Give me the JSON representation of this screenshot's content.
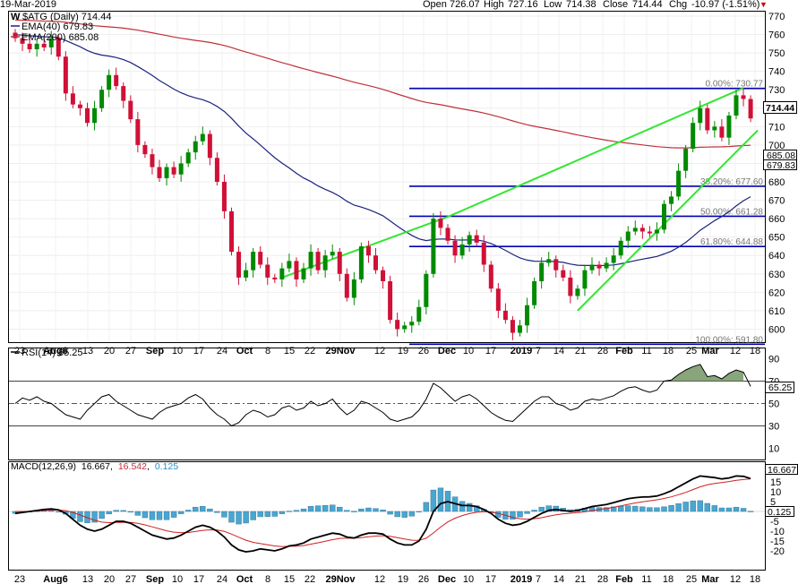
{
  "header": {
    "date": "19-Mar-2019",
    "open_label": "Open",
    "open": "726.07",
    "high_label": "High",
    "high": "727.16",
    "low_label": "Low",
    "low": "714.38",
    "close_label": "Close",
    "close": "714.44",
    "chg_label": "Chg",
    "chg": "-10.97 (-1.51%)"
  },
  "legend": {
    "title": "$ATG (Daily) 714.44",
    "ema40": "EMA(40) 679.83",
    "ema200": "EMA(200) 685.08"
  },
  "price_tags": {
    "close": "714.44",
    "ema200": "685.08",
    "ema40": "679.83"
  },
  "fib_labels": [
    "0.00%: 730.77",
    "38.20%: 677.60",
    "50.00%: 661.28",
    "61.80%: 644.88",
    "100.00%: 591.80"
  ],
  "rsi_legend": "RSI(14) 65.25",
  "rsi_tag": "65.25",
  "macd_legend": {
    "label": "MACD(12,26,9)",
    "macd": "16.667",
    "signal": "16.542",
    "hist": "0.125"
  },
  "macd_tags": {
    "macd": "16.667",
    "hist": "0.125"
  },
  "x_axis_labels": [
    "23",
    "Aug6",
    "13",
    "20",
    "27",
    "Sep",
    "10",
    "17",
    "24",
    "Oct",
    "8",
    "15",
    "22",
    "29Nov",
    "12",
    "19",
    "26",
    "Dec",
    "10",
    "17",
    "2019",
    "7",
    "14",
    "21",
    "28",
    "Feb",
    "11",
    "18",
    "25",
    "Mar",
    "12",
    "18"
  ],
  "colors": {
    "up": "#008a00",
    "down": "#d01037",
    "ema40": "#1a237e",
    "ema200": "#c0303a",
    "fib": "#0000b4",
    "trend": "#33e633",
    "macd_hist": "#4aa6d0",
    "rsi_fill": "#6b8e5a"
  },
  "chart_data": [
    {
      "type": "candlestick",
      "title": "$ATG (Daily)",
      "ylim": [
        590,
        770
      ],
      "y_ticks": [
        600,
        610,
        620,
        630,
        640,
        650,
        660,
        670,
        680,
        690,
        700,
        710,
        720,
        730,
        740,
        750,
        760,
        770
      ],
      "series": [
        {
          "name": "$ATG (Daily)",
          "points": [
            [
              1,
              758
            ],
            [
              2,
              755
            ],
            [
              3,
              752
            ],
            [
              4,
              755
            ],
            [
              5,
              753
            ],
            [
              6,
              758
            ],
            [
              7,
              748
            ],
            [
              8,
              728
            ],
            [
              9,
              722
            ],
            [
              10,
              720
            ],
            [
              11,
              712
            ],
            [
              12,
              720
            ],
            [
              13,
              730
            ],
            [
              14,
              738
            ],
            [
              15,
              732
            ],
            [
              16,
              724
            ],
            [
              17,
              714
            ],
            [
              18,
              700
            ],
            [
              19,
              695
            ],
            [
              20,
              688
            ],
            [
              21,
              682
            ],
            [
              22,
              688
            ],
            [
              23,
              684
            ],
            [
              24,
              690
            ],
            [
              25,
              696
            ],
            [
              26,
              702
            ],
            [
              27,
              706
            ],
            [
              28,
              693
            ],
            [
              29,
              680
            ],
            [
              30,
              664
            ],
            [
              31,
              642
            ],
            [
              32,
              628
            ],
            [
              33,
              632
            ],
            [
              34,
              642
            ],
            [
              35,
              635
            ],
            [
              36,
              628
            ],
            [
              37,
              627
            ],
            [
              38,
              633
            ],
            [
              39,
              637
            ],
            [
              40,
              627
            ],
            [
              41,
              633
            ],
            [
              42,
              642
            ],
            [
              43,
              632
            ],
            [
              44,
              640
            ],
            [
              45,
              642
            ],
            [
              46,
              630
            ],
            [
              47,
              617
            ],
            [
              48,
              627
            ],
            [
              49,
              645
            ],
            [
              50,
              640
            ],
            [
              51,
              632
            ],
            [
              52,
              626
            ],
            [
              53,
              605
            ],
            [
              54,
              600
            ],
            [
              55,
              602
            ],
            [
              56,
              604
            ],
            [
              57,
              612
            ],
            [
              58,
              630
            ],
            [
              59,
              660
            ],
            [
              60,
              655
            ],
            [
              61,
              648
            ],
            [
              62,
              640
            ],
            [
              63,
              646
            ],
            [
              64,
              651
            ],
            [
              65,
              647
            ],
            [
              66,
              635
            ],
            [
              67,
              622
            ],
            [
              68,
              610
            ],
            [
              69,
              605
            ],
            [
              70,
              598
            ],
            [
              71,
              602
            ],
            [
              72,
              613
            ],
            [
              73,
              626
            ],
            [
              74,
              636
            ],
            [
              75,
              638
            ],
            [
              76,
              632
            ],
            [
              77,
              628
            ],
            [
              78,
              618
            ],
            [
              79,
              622
            ],
            [
              80,
              632
            ],
            [
              81,
              635
            ],
            [
              82,
              633
            ],
            [
              83,
              636
            ],
            [
              84,
              640
            ],
            [
              85,
              648
            ],
            [
              86,
              653
            ],
            [
              87,
              655
            ],
            [
              88,
              653
            ],
            [
              89,
              652
            ],
            [
              90,
              654
            ],
            [
              91,
              668
            ],
            [
              92,
              672
            ],
            [
              93,
              686
            ],
            [
              94,
              698
            ],
            [
              95,
              712
            ],
            [
              96,
              720
            ],
            [
              97,
              708
            ],
            [
              98,
              710
            ],
            [
              99,
              704
            ],
            [
              100,
              716
            ],
            [
              101,
              727
            ],
            [
              102,
              725
            ],
            [
              103,
              714.44
            ]
          ]
        },
        {
          "name": "EMA(40)",
          "value": 679.83
        },
        {
          "name": "EMA(200)",
          "value": 685.08
        }
      ],
      "fibonacci": [
        {
          "level": "0.00%",
          "value": 730.77
        },
        {
          "level": "38.20%",
          "value": 677.6
        },
        {
          "level": "50.00%",
          "value": 661.28
        },
        {
          "level": "61.80%",
          "value": 644.88
        },
        {
          "level": "100.00%",
          "value": 591.8
        }
      ],
      "ohlc_last": {
        "open": 726.07,
        "high": 727.16,
        "low": 714.38,
        "close": 714.44,
        "change": -10.97,
        "change_pct": -1.51
      }
    },
    {
      "type": "line",
      "title": "RSI(14)",
      "ylim": [
        0,
        100
      ],
      "y_ticks": [
        10,
        30,
        50,
        70,
        90
      ],
      "reference_lines": [
        30,
        50,
        70
      ],
      "series": [
        {
          "name": "RSI(14)",
          "last": 65.25,
          "values": [
            50,
            55,
            53,
            56,
            52,
            50,
            45,
            40,
            38,
            36,
            44,
            50,
            56,
            58,
            52,
            48,
            44,
            40,
            38,
            36,
            42,
            46,
            48,
            50,
            55,
            58,
            54,
            46,
            40,
            36,
            30,
            33,
            40,
            44,
            42,
            38,
            40,
            46,
            48,
            44,
            46,
            52,
            48,
            50,
            54,
            46,
            40,
            44,
            52,
            50,
            46,
            42,
            36,
            34,
            36,
            38,
            44,
            54,
            68,
            64,
            58,
            52,
            56,
            58,
            54,
            48,
            42,
            38,
            35,
            34,
            40,
            46,
            52,
            56,
            56,
            50,
            48,
            44,
            46,
            52,
            54,
            53,
            55,
            57,
            61,
            64,
            65,
            62,
            60,
            62,
            70,
            71,
            76,
            80,
            83,
            85,
            74,
            75,
            72,
            77,
            80,
            78,
            65.25
          ]
        }
      ]
    },
    {
      "type": "line",
      "title": "MACD(12,26,9)",
      "ylim": [
        -22,
        22
      ],
      "y_ticks": [
        -20,
        -15,
        -10,
        -5,
        0,
        5,
        10,
        15
      ],
      "series": [
        {
          "name": "MACD",
          "last": 16.667,
          "values": [
            -1,
            -0.5,
            0,
            0.5,
            1,
            1.3,
            0.8,
            -1,
            -4,
            -7,
            -9,
            -10,
            -9,
            -7,
            -5,
            -5,
            -6,
            -8,
            -10,
            -12,
            -13,
            -14,
            -13.5,
            -12,
            -10,
            -8,
            -7,
            -8,
            -10,
            -13,
            -17,
            -19.5,
            -20.5,
            -20,
            -19,
            -19.5,
            -20,
            -19,
            -17.5,
            -17,
            -16,
            -14,
            -13,
            -12,
            -11,
            -11.5,
            -13,
            -13.5,
            -12,
            -11,
            -11,
            -11.5,
            -14,
            -16,
            -17,
            -17,
            -15,
            -9,
            0,
            4,
            5,
            4,
            3,
            3,
            2.5,
            1,
            -1,
            -4,
            -6,
            -7,
            -6.5,
            -5,
            -3,
            -1,
            0.5,
            1,
            0.5,
            0,
            0.5,
            1.5,
            2.5,
            3,
            3.5,
            4.5,
            5.5,
            6.5,
            7,
            7.3,
            7.4,
            7.8,
            9,
            10.5,
            12.5,
            14.5,
            16.5,
            18,
            17.6,
            17.2,
            16.5,
            17,
            18,
            17.8,
            16.667
          ]
        },
        {
          "name": "Signal",
          "last": 16.542,
          "values": [
            0,
            0,
            0,
            0.2,
            0.5,
            0.7,
            0.8,
            0.4,
            -0.5,
            -1.8,
            -3.2,
            -4.5,
            -5.4,
            -5.7,
            -5.6,
            -5.5,
            -5.6,
            -6,
            -6.8,
            -7.8,
            -8.8,
            -9.8,
            -10.5,
            -10.8,
            -10.7,
            -10.2,
            -9.6,
            -9.3,
            -9.4,
            -10.1,
            -11.5,
            -13.1,
            -14.6,
            -15.7,
            -16.3,
            -16.9,
            -17.5,
            -17.8,
            -17.7,
            -17.6,
            -17.3,
            -16.6,
            -15.9,
            -15.1,
            -14.3,
            -13.7,
            -13.6,
            -13.6,
            -13.3,
            -12.8,
            -12.5,
            -12.3,
            -12.6,
            -13.3,
            -14,
            -14.6,
            -14.7,
            -13.6,
            -10.9,
            -7.9,
            -5.3,
            -3.4,
            -2.1,
            -1.1,
            -0.4,
            -0.1,
            -0.3,
            -1,
            -2,
            -3,
            -3.7,
            -3.9,
            -3.7,
            -3.2,
            -2.4,
            -1.7,
            -1.2,
            -0.9,
            -0.6,
            -0.2,
            0.4,
            1,
            1.5,
            2.1,
            2.8,
            3.6,
            4.3,
            4.9,
            5.4,
            5.9,
            6.6,
            7.4,
            8.5,
            9.7,
            11.1,
            12.5,
            13.5,
            14.2,
            14.7,
            15.2,
            15.8,
            16.2,
            16.542
          ]
        },
        {
          "name": "Histogram",
          "last": 0.125
        }
      ]
    }
  ]
}
